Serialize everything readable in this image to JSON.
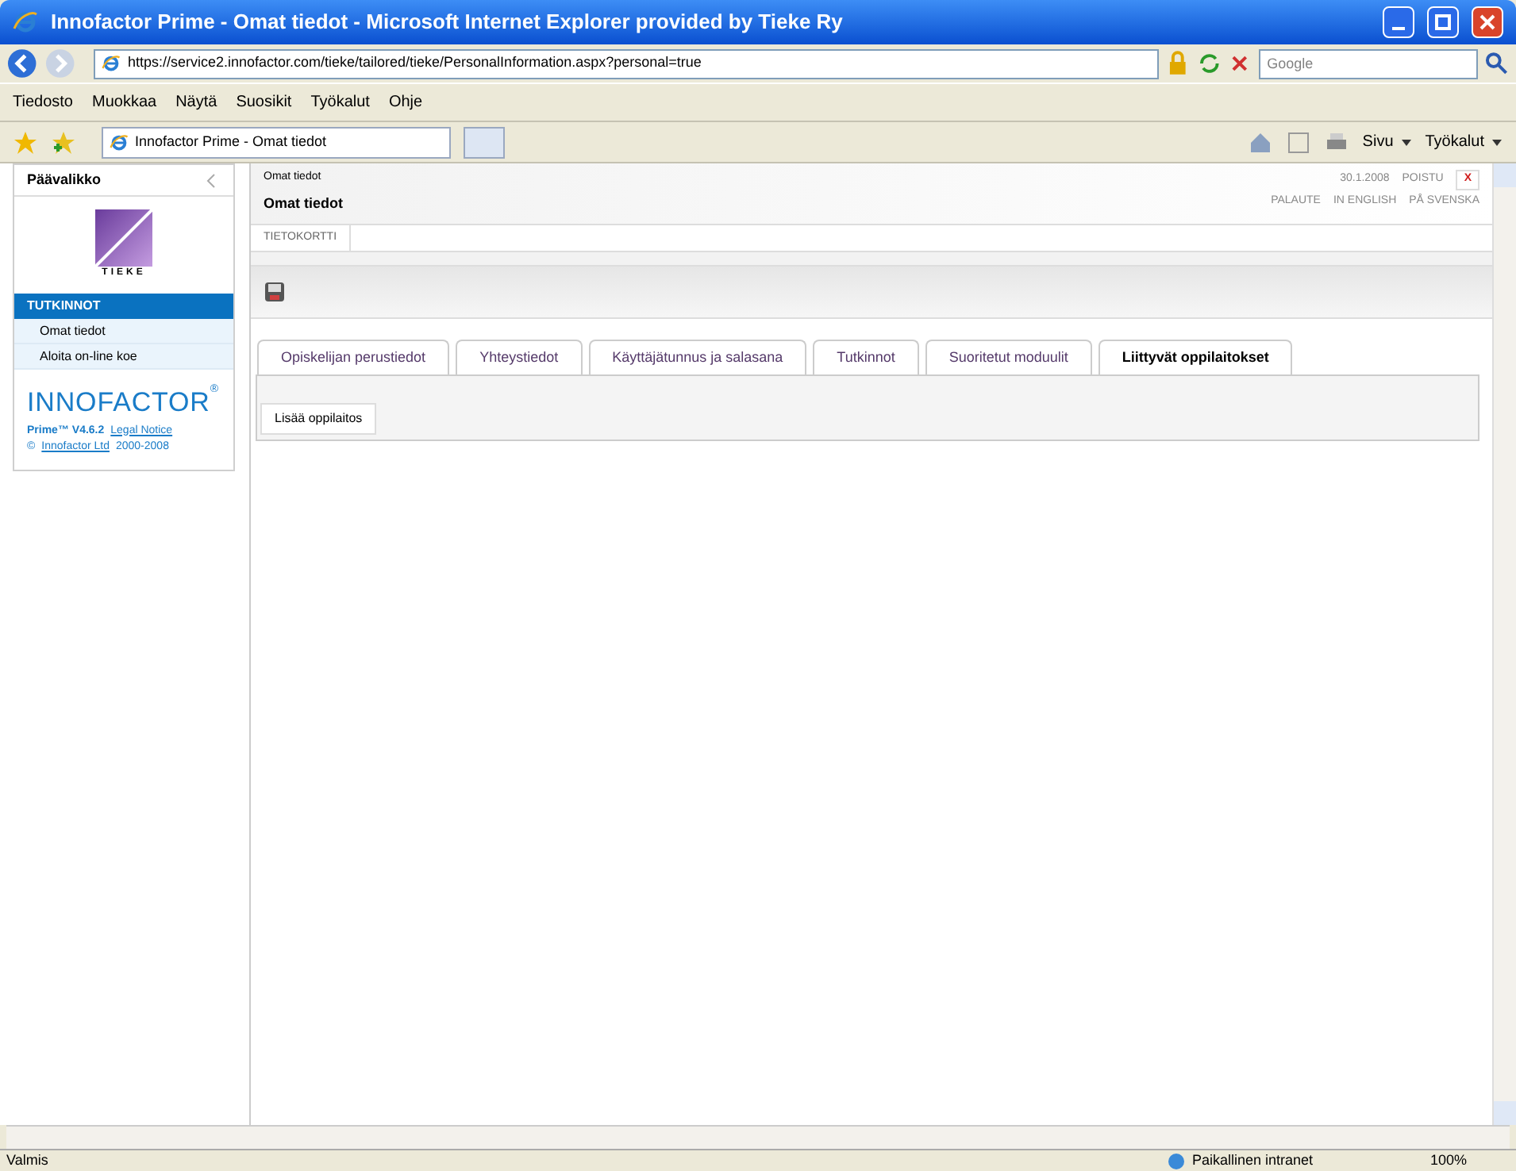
{
  "window": {
    "title": "Innofactor Prime - Omat tiedot - Microsoft Internet Explorer provided by Tieke Ry"
  },
  "address_bar": {
    "url": "https://service2.innofactor.com/tieke/tailored/tieke/PersonalInformation.aspx?personal=true",
    "search_placeholder": "Google"
  },
  "menu": [
    "Tiedosto",
    "Muokkaa",
    "Näytä",
    "Suosikit",
    "Työkalut",
    "Ohje"
  ],
  "browser_tab": {
    "title": "Innofactor Prime - Omat tiedot"
  },
  "command_bar": [
    "Sivu",
    "Työkalut"
  ],
  "sidebar": {
    "title": "Päävalikko",
    "logo_text": "TIEKE",
    "section": "TUTKINNOT",
    "items": [
      {
        "label": "Omat tiedot",
        "selected": false
      },
      {
        "label": "Aloita on-line koe",
        "selected": false
      }
    ],
    "brand": "INNOFACTOR",
    "brand_mark": "®",
    "version": "Prime™ V4.6.2",
    "legal_link": "Legal Notice",
    "copyright_symbol": "©",
    "company_link": "Innofactor Ltd",
    "years": "2000-2008"
  },
  "header": {
    "breadcrumb": "Omat tiedot",
    "title": "Omat tiedot",
    "date": "30.1.2008",
    "logout": "POISTU",
    "close": "X",
    "links": [
      "PALAUTE",
      "IN ENGLISH",
      "PÅ SVENSKA"
    ],
    "card_tab": "TIETOKORTTI"
  },
  "tabs": [
    {
      "label": "Opiskelijan perustiedot",
      "selected": false
    },
    {
      "label": "Yhteystiedot",
      "selected": false
    },
    {
      "label": "Käyttäjätunnus ja salasana",
      "selected": false
    },
    {
      "label": "Tutkinnot",
      "selected": false
    },
    {
      "label": "Suoritetut moduulit",
      "selected": false
    },
    {
      "label": "Liittyvät oppilaitokset",
      "selected": true
    }
  ],
  "add_button": "Lisää oppilaitos",
  "status_bar": {
    "status": "Valmis",
    "zone": "Paikallinen intranet",
    "zoom": "100%"
  }
}
